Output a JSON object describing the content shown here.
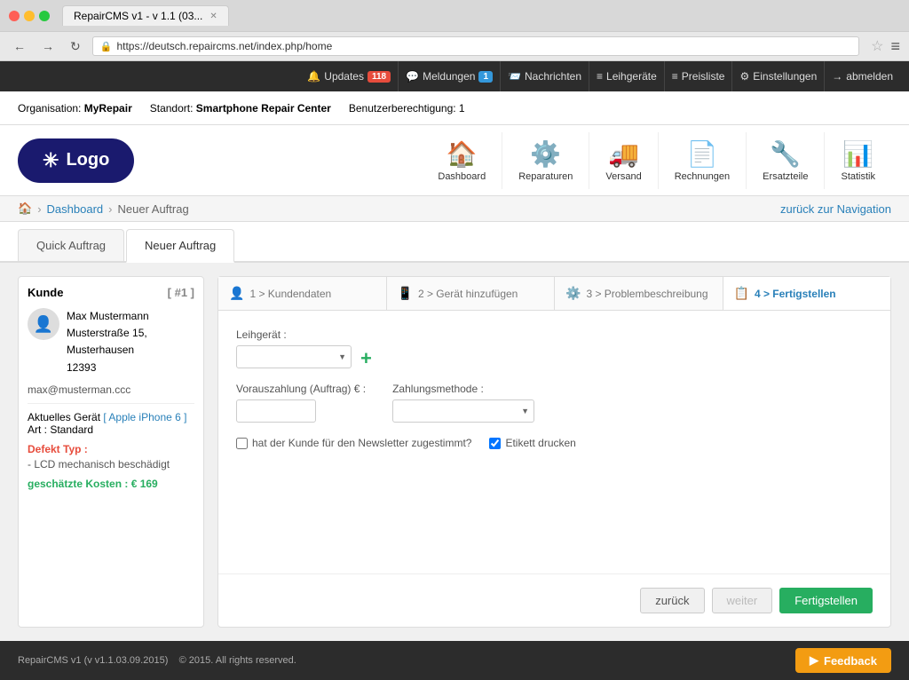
{
  "browser": {
    "tab_title": "RepairCMS v1 - v 1.1 (03...",
    "url": "https://deutsch.repaircms.net/index.php/home",
    "back_disabled": false,
    "forward_disabled": false
  },
  "top_navbar": {
    "updates_label": "Updates",
    "updates_badge": "118",
    "meldungen_label": "Meldungen",
    "meldungen_badge": "1",
    "nachrichten_label": "Nachrichten",
    "leihgeraete_label": "Leihgeräte",
    "preisliste_label": "Preisliste",
    "einstellungen_label": "Einstellungen",
    "abmelden_label": "abmelden"
  },
  "sub_header": {
    "org_label": "Organisation:",
    "org_name": "MyRepair",
    "standort_label": "Standort:",
    "standort_name": "Smartphone Repair Center",
    "berechtigung_label": "Benutzerberechtigung: 1"
  },
  "main_header": {
    "logo_text": "Logo",
    "nav_items": [
      {
        "id": "dashboard",
        "label": "Dashboard",
        "icon": "🏠",
        "active": true
      },
      {
        "id": "reparaturen",
        "label": "Reparaturen",
        "icon": "⚙️",
        "active": false
      },
      {
        "id": "versand",
        "label": "Versand",
        "icon": "🚚",
        "active": false
      },
      {
        "id": "rechnungen",
        "label": "Rechnungen",
        "icon": "📄",
        "active": false
      },
      {
        "id": "ersatzteile",
        "label": "Ersatzteile",
        "icon": "🔧",
        "active": false
      },
      {
        "id": "statistik",
        "label": "Statistik",
        "icon": "📊",
        "active": false
      }
    ]
  },
  "breadcrumb": {
    "items": [
      "Dashboard",
      "Neuer Auftrag"
    ],
    "back_link": "zurück zur Navigation"
  },
  "tabs": [
    {
      "id": "quick",
      "label": "Quick Auftrag",
      "active": false
    },
    {
      "id": "neu",
      "label": "Neuer Auftrag",
      "active": true
    }
  ],
  "customer_panel": {
    "title": "Kunde",
    "id": "[ #1 ]",
    "name": "Max Mustermann",
    "address": "Musterstraße 15, Musterhausen",
    "zip": "12393",
    "email": "max@musterman.ccc",
    "device_label": "Aktuelles Gerät",
    "device_name": "[ Apple iPhone 6 ]",
    "device_art": "Art : Standard",
    "defect_label": "Defekt Typ :",
    "defect_value": "- LCD mechanisch beschädigt",
    "cost_label": "geschätzte Kosten : € 169"
  },
  "steps": [
    {
      "id": "step1",
      "label": "1 > Kundendaten",
      "icon": "👤",
      "active": false
    },
    {
      "id": "step2",
      "label": "2 > Gerät hinzufügen",
      "icon": "📱",
      "active": false
    },
    {
      "id": "step3",
      "label": "3 > Problembeschreibung",
      "icon": "⚙️",
      "active": false
    },
    {
      "id": "step4",
      "label": "4 > Fertigstellen",
      "icon": "📋",
      "active": true
    }
  ],
  "form": {
    "leihgeraet_label": "Leihgerät :",
    "leihgeraet_placeholder": "",
    "add_btn_label": "+",
    "vorauszahlung_label": "Vorauszahlung (Auftrag) € :",
    "vorauszahlung_value": "",
    "zahlungsmethode_label": "Zahlungsmethode :",
    "zahlungsmethode_value": "",
    "newsletter_label": "hat der Kunde für den Newsletter zugestimmt?",
    "newsletter_checked": false,
    "etikett_label": "Etikett drucken",
    "etikett_checked": true,
    "btn_back": "zurück",
    "btn_weiter": "weiter",
    "btn_fertigstellen": "Fertigstellen"
  },
  "footer": {
    "copyright": "RepairCMS v1 (v v1.1.03.09.2015)",
    "rights": "© 2015. All rights reserved.",
    "feedback_label": "Feedback"
  }
}
